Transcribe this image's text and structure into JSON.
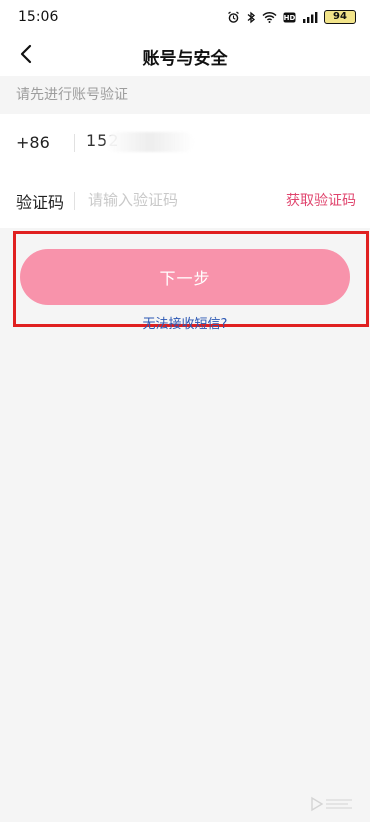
{
  "status_bar": {
    "time": "15:06",
    "battery": "94",
    "icons": [
      "alarm-icon",
      "bluetooth-icon",
      "wifi-icon",
      "hd-icon",
      "signal-icon",
      "battery-icon"
    ]
  },
  "nav": {
    "title": "账号与安全",
    "back_icon": "chevron-left-icon"
  },
  "form": {
    "hint": "请先进行账号验证",
    "phone_prefix": "+86",
    "phone_visible": "152",
    "code_label": "验证码",
    "code_placeholder": "请输入验证码",
    "get_code_label": "获取验证码"
  },
  "actions": {
    "next_label": "下一步",
    "sms_help_label": "无法接收短信?"
  },
  "colors": {
    "accent": "#e0456e",
    "button": "#f893ab",
    "highlight": "#e02020",
    "link": "#2b57b3"
  }
}
